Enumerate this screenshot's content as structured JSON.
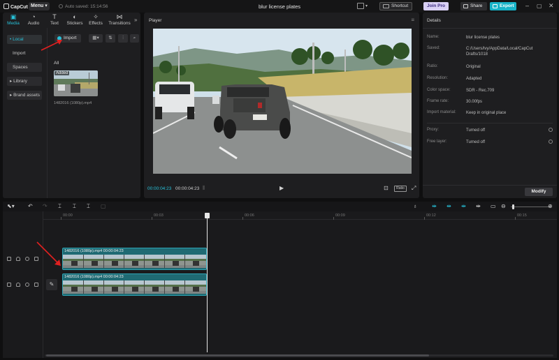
{
  "app": {
    "logo": "CapCut",
    "menu_label": "Menu",
    "autosave": "Auto saved: 15:14:56",
    "project_title": "blur license plates",
    "shortcut_label": "Shortcut",
    "joinpro_label": "Join Pro",
    "share_label": "Share",
    "export_label": "Export"
  },
  "media_tabs": [
    {
      "label": "Media",
      "icon": "media-icon",
      "active": true
    },
    {
      "label": "Audio",
      "icon": "audio-icon"
    },
    {
      "label": "Text",
      "icon": "text-icon"
    },
    {
      "label": "Stickers",
      "icon": "stickers-icon"
    },
    {
      "label": "Effects",
      "icon": "effects-icon"
    },
    {
      "label": "Transitions",
      "icon": "transitions-icon"
    }
  ],
  "side_nav": [
    {
      "label": "• Local",
      "active": true
    },
    {
      "label": "Import"
    },
    {
      "label": "Spaces"
    },
    {
      "label": "▸ Library"
    },
    {
      "label": "▸ Brand assets"
    }
  ],
  "media": {
    "import_label": "Import",
    "all_label": "All",
    "thumbnail_badge": "Added",
    "thumbnail_name": "1482016 (1080p).mp4"
  },
  "player": {
    "title": "Player",
    "current_time": "00:00:04:23",
    "duration": "00:00:04:23",
    "ratio_label": "Ratio"
  },
  "details": {
    "title": "Details",
    "rows": [
      {
        "key": "Name:",
        "value": "blur license plates"
      },
      {
        "key": "Saved:",
        "value": "C:/Users/lvy/AppData/Local/CapCut Drafts/1018"
      },
      {
        "key": "Ratio:",
        "value": "Original"
      },
      {
        "key": "Resolution:",
        "value": "Adapted"
      },
      {
        "key": "Color space:",
        "value": "SDR - Rec.709"
      },
      {
        "key": "Frame rate:",
        "value": "30.00fps"
      },
      {
        "key": "Import material:",
        "value": "Keep in original place"
      }
    ],
    "extra_rows": [
      {
        "key": "Proxy:",
        "value": "Turned off"
      },
      {
        "key": "Free layer:",
        "value": "Turned off"
      }
    ],
    "modify_label": "Modify"
  },
  "timeline": {
    "ruler_labels": [
      "00:00",
      "00:03",
      "00:06",
      "00:09",
      "00:12",
      "00:15"
    ],
    "clips": [
      {
        "label": "1482016 (1080p).mp4   00:00:04:23"
      },
      {
        "label": "1482016 (1080p).mp4   00:00:04:23"
      }
    ]
  },
  "colors": {
    "accent": "#27c1d9",
    "export": "#18b3c8",
    "clip": "#1f6a73",
    "arrow": "#e02020"
  }
}
